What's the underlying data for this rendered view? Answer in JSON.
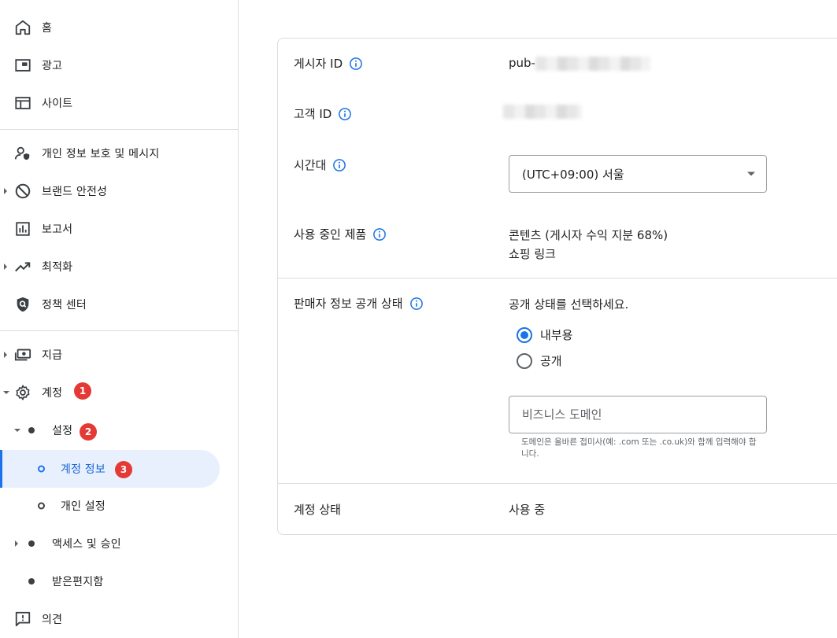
{
  "sidebar": {
    "home": "홈",
    "ads": "광고",
    "sites": "사이트",
    "privacy": "개인 정보 보호 및 메시지",
    "brand_safety": "브랜드 안전성",
    "reports": "보고서",
    "optimization": "최적화",
    "policy_center": "정책 센터",
    "payments": "지급",
    "account": "계정",
    "settings": "설정",
    "account_info": "계정 정보",
    "personal_settings": "개인 설정",
    "access": "액세스 및 승인",
    "inbox": "받은편지함",
    "feedback": "의견",
    "badges": [
      "1",
      "2",
      "3"
    ]
  },
  "account": {
    "publisher_id_label": "게시자 ID",
    "publisher_id_value": "pub-",
    "customer_id_label": "고객 ID",
    "timezone_label": "시간대",
    "timezone_value": "(UTC+09:00) 서울",
    "products_label": "사용 중인 제품",
    "products": [
      "콘텐츠 (게시자 수익 지분 68%)",
      "쇼핑 링크"
    ],
    "seller_info_label": "판매자 정보 공개 상태",
    "seller_prompt": "공개 상태를 선택하세요.",
    "radio_internal": "내부용",
    "radio_public": "공개",
    "domain_placeholder": "비즈니스 도메인",
    "domain_helper": "도메인은 올바른 접미사(예: .com 또는 .co.uk)와 함께 입력해야 합니다.",
    "status_label": "계정 상태",
    "status_value": "사용 중"
  },
  "colors": {
    "accent": "#1a73e8",
    "badge": "#e53935",
    "active_bg": "#e8f0fe"
  }
}
